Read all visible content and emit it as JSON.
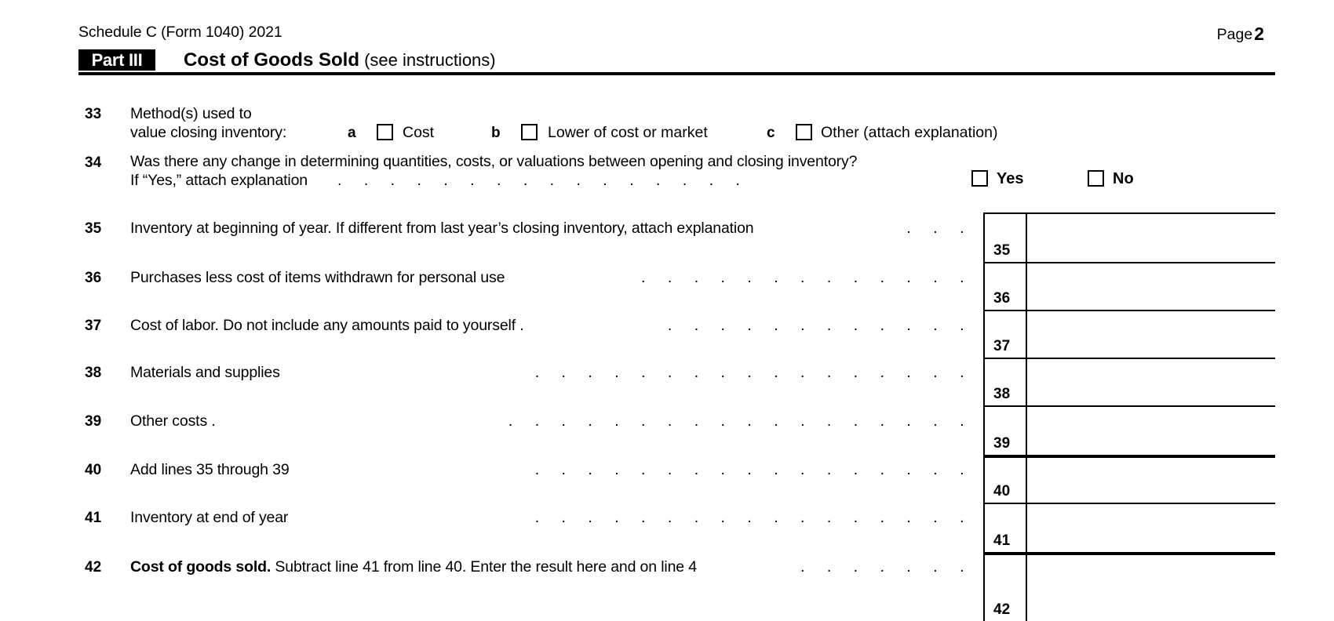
{
  "header": {
    "left": "Schedule C (Form 1040) 2021",
    "page_label": "Page",
    "page_number": "2"
  },
  "part": {
    "tag": "Part III",
    "title": "Cost of Goods Sold",
    "title_note": "(see instructions)"
  },
  "line33": {
    "number": "33",
    "text_line1": "Method(s) used to",
    "text_line2": "value closing inventory:",
    "options": [
      {
        "letter": "a",
        "label": "Cost"
      },
      {
        "letter": "b",
        "label": "Lower of cost or market"
      },
      {
        "letter": "c",
        "label": "Other (attach explanation)"
      }
    ]
  },
  "line34": {
    "number": "34",
    "text_line1": "Was there any change in determining quantities, costs, or valuations between opening and closing inventory?",
    "text_line2": "If “Yes,” attach explanation",
    "leader": ".  .  .  .  .  .  .  .  .  .  .  .  .  .  .  .",
    "yes_label": "Yes",
    "no_label": "No"
  },
  "lines": [
    {
      "number": "35",
      "text": "Inventory at beginning of year. If different from last year’s closing inventory, attach explanation",
      "text_bold": "",
      "leader": ".  .  .",
      "thick_top": false
    },
    {
      "number": "36",
      "text": "Purchases less cost of items withdrawn for personal use",
      "text_bold": "",
      "leader": ".  .  .  .  .  .  .  .  .  .  .  .  .",
      "thick_top": false
    },
    {
      "number": "37",
      "text": "Cost of labor. Do not include any amounts paid to yourself .",
      "text_bold": "",
      "leader": ".  .  .  .  .  .  .  .  .  .  .  .",
      "thick_top": false
    },
    {
      "number": "38",
      "text": "Materials and supplies",
      "text_bold": "",
      "leader": ".  .  .  .  .  .  .  .  .  .  .  .  .  .  .  .  .",
      "thick_top": false
    },
    {
      "number": "39",
      "text": "Other costs .",
      "text_bold": "",
      "leader": ".  .  .  .  .  .  .  .  .  .  .  .  .  .  .  .  .  .",
      "thick_top": false
    },
    {
      "number": "40",
      "text": "Add lines 35 through 39",
      "text_bold": "",
      "leader": ".  .  .  .  .  .  .  .  .  .  .  .  .  .  .  .  .",
      "thick_top": true
    },
    {
      "number": "41",
      "text": "Inventory at end of year",
      "text_bold": "",
      "leader": ".  .  .  .  .  .  .  .  .  .  .  .  .  .  .  .  .",
      "thick_top": false
    },
    {
      "number": "42",
      "text": " Subtract line 41 from line 40. Enter the result here and on line 4",
      "text_bold": "Cost of goods sold.",
      "leader": ".  .  .  .  .  .  .",
      "thick_top": true
    }
  ]
}
